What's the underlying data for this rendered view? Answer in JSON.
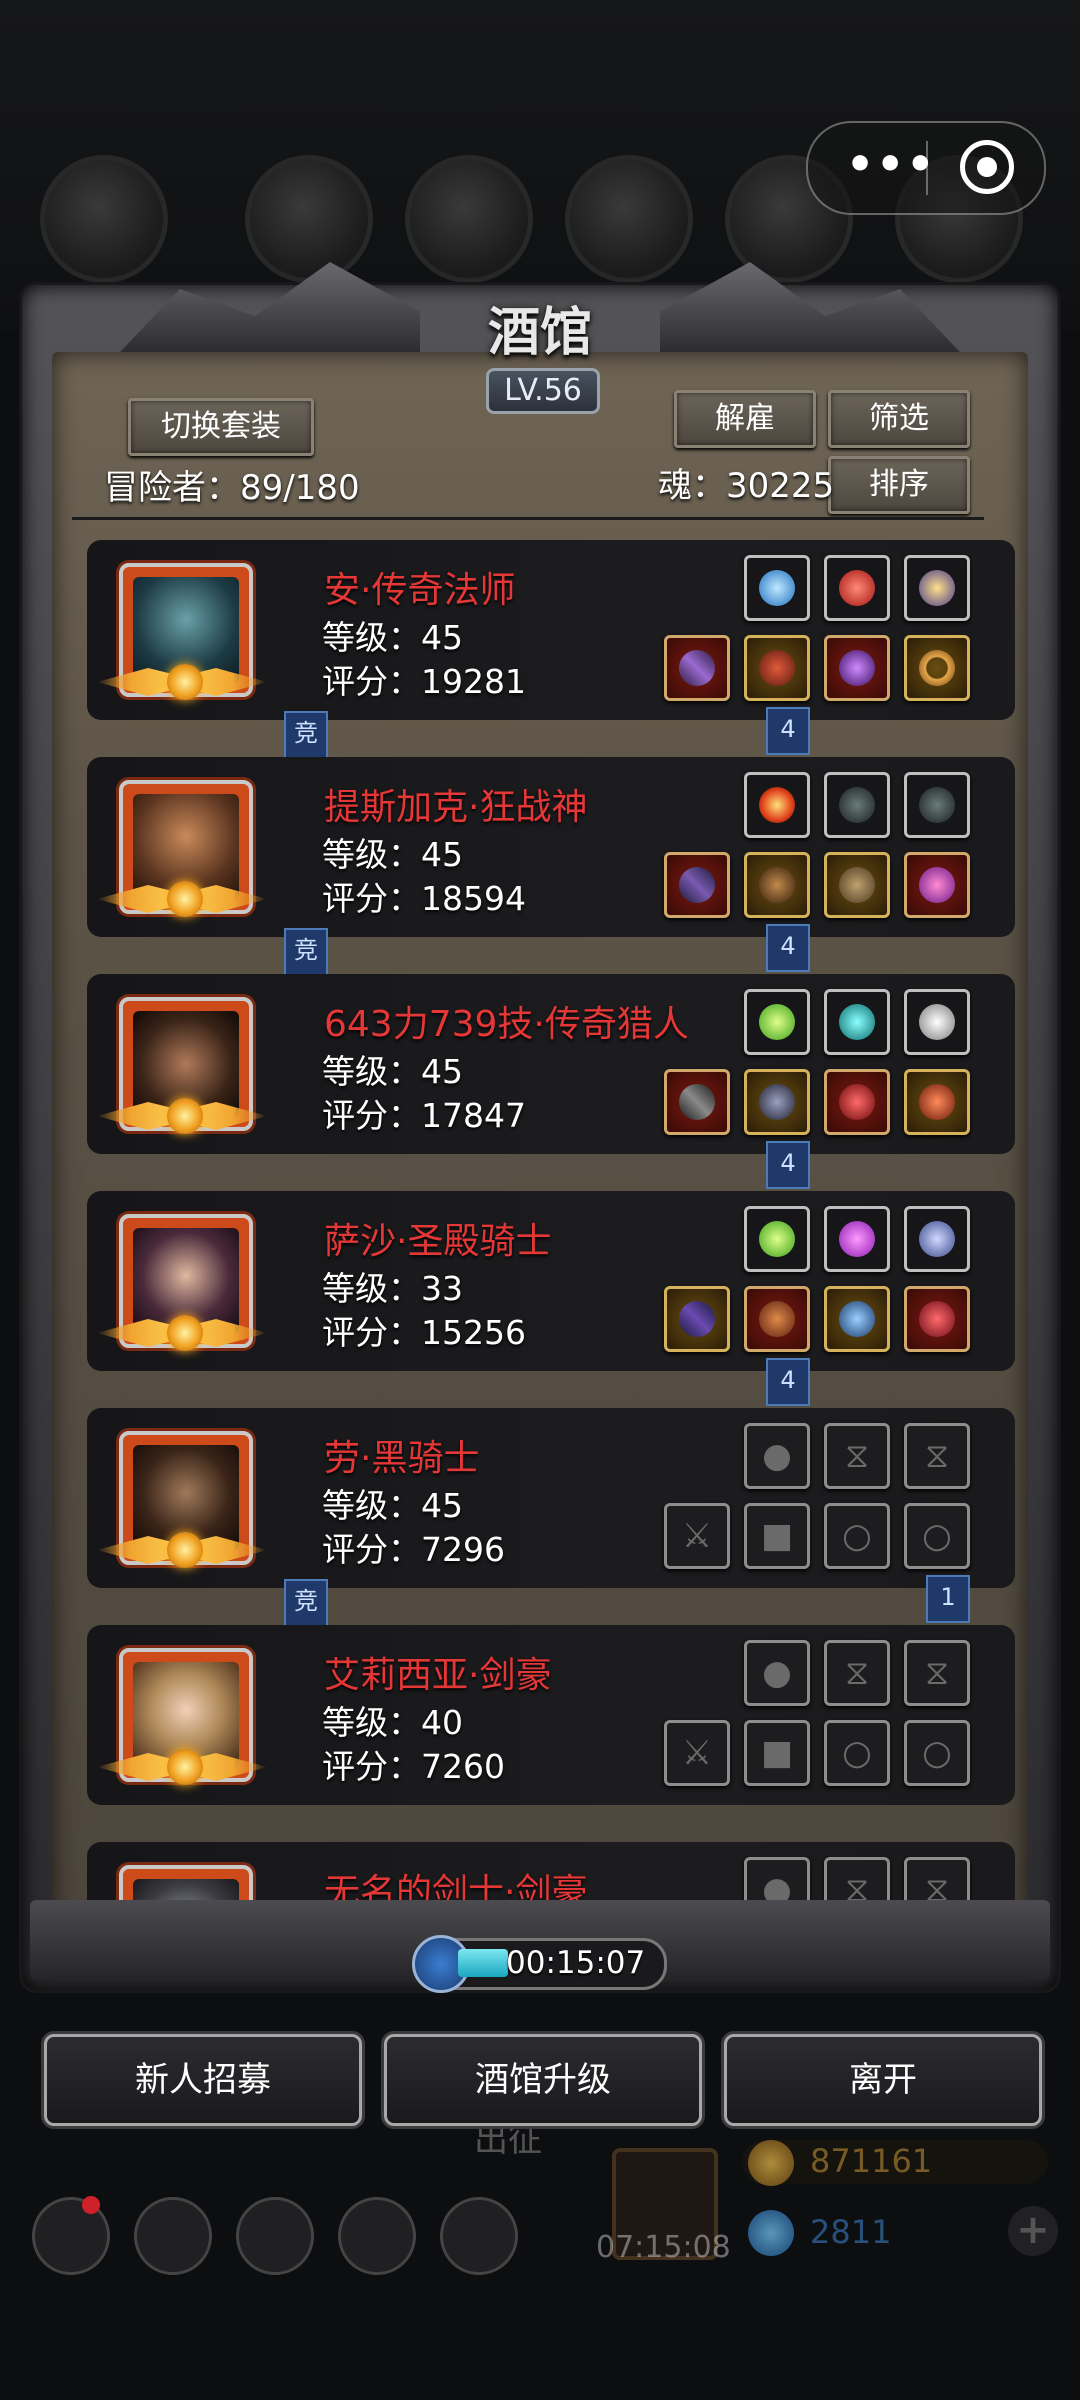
{
  "window": {
    "title": "酒馆",
    "level": "LV.56"
  },
  "toolbar": {
    "switch_outfit": "切换套装",
    "dismiss": "解雇",
    "filter": "筛选",
    "sort": "排序"
  },
  "stats": {
    "adventurers": "冒险者：89/180",
    "soul": "魂：30225"
  },
  "heroes": [
    {
      "name": "安·传奇法师",
      "level": "等级：45",
      "score": "评分：19281",
      "left_tag": "竞",
      "right_tag": "4"
    },
    {
      "name": "提斯加克·狂战神",
      "level": "等级：45",
      "score": "评分：18594",
      "left_tag": "竞",
      "right_tag": "4"
    },
    {
      "name": "643力739技·传奇猎人",
      "level": "等级：45",
      "score": "评分：17847",
      "left_tag": "",
      "right_tag": "4"
    },
    {
      "name": "萨沙·圣殿骑士",
      "level": "等级：33",
      "score": "评分：15256",
      "left_tag": "",
      "right_tag": "4"
    },
    {
      "name": "劳·黑骑士",
      "level": "等级：45",
      "score": "评分：7296",
      "left_tag": "竞",
      "right_tag": "1"
    },
    {
      "name": "艾莉西亚·剑豪",
      "level": "等级：40",
      "score": "评分：7260",
      "left_tag": "",
      "right_tag": ""
    },
    {
      "name": "无名的剑士·剑豪",
      "level": "",
      "score": "",
      "left_tag": "",
      "right_tag": ""
    }
  ],
  "timer": {
    "time": "00:15:07"
  },
  "actions": {
    "recruit": "新人招募",
    "upgrade": "酒馆升级",
    "leave": "离开"
  },
  "background": {
    "depart": "出征",
    "gift_timer": "07:15:08",
    "gold": "871161",
    "gems": "2811",
    "add": "+"
  },
  "colors": {
    "hero_name": "#e63737",
    "parchment": "#5d5447",
    "emblem": "#f0a530"
  }
}
